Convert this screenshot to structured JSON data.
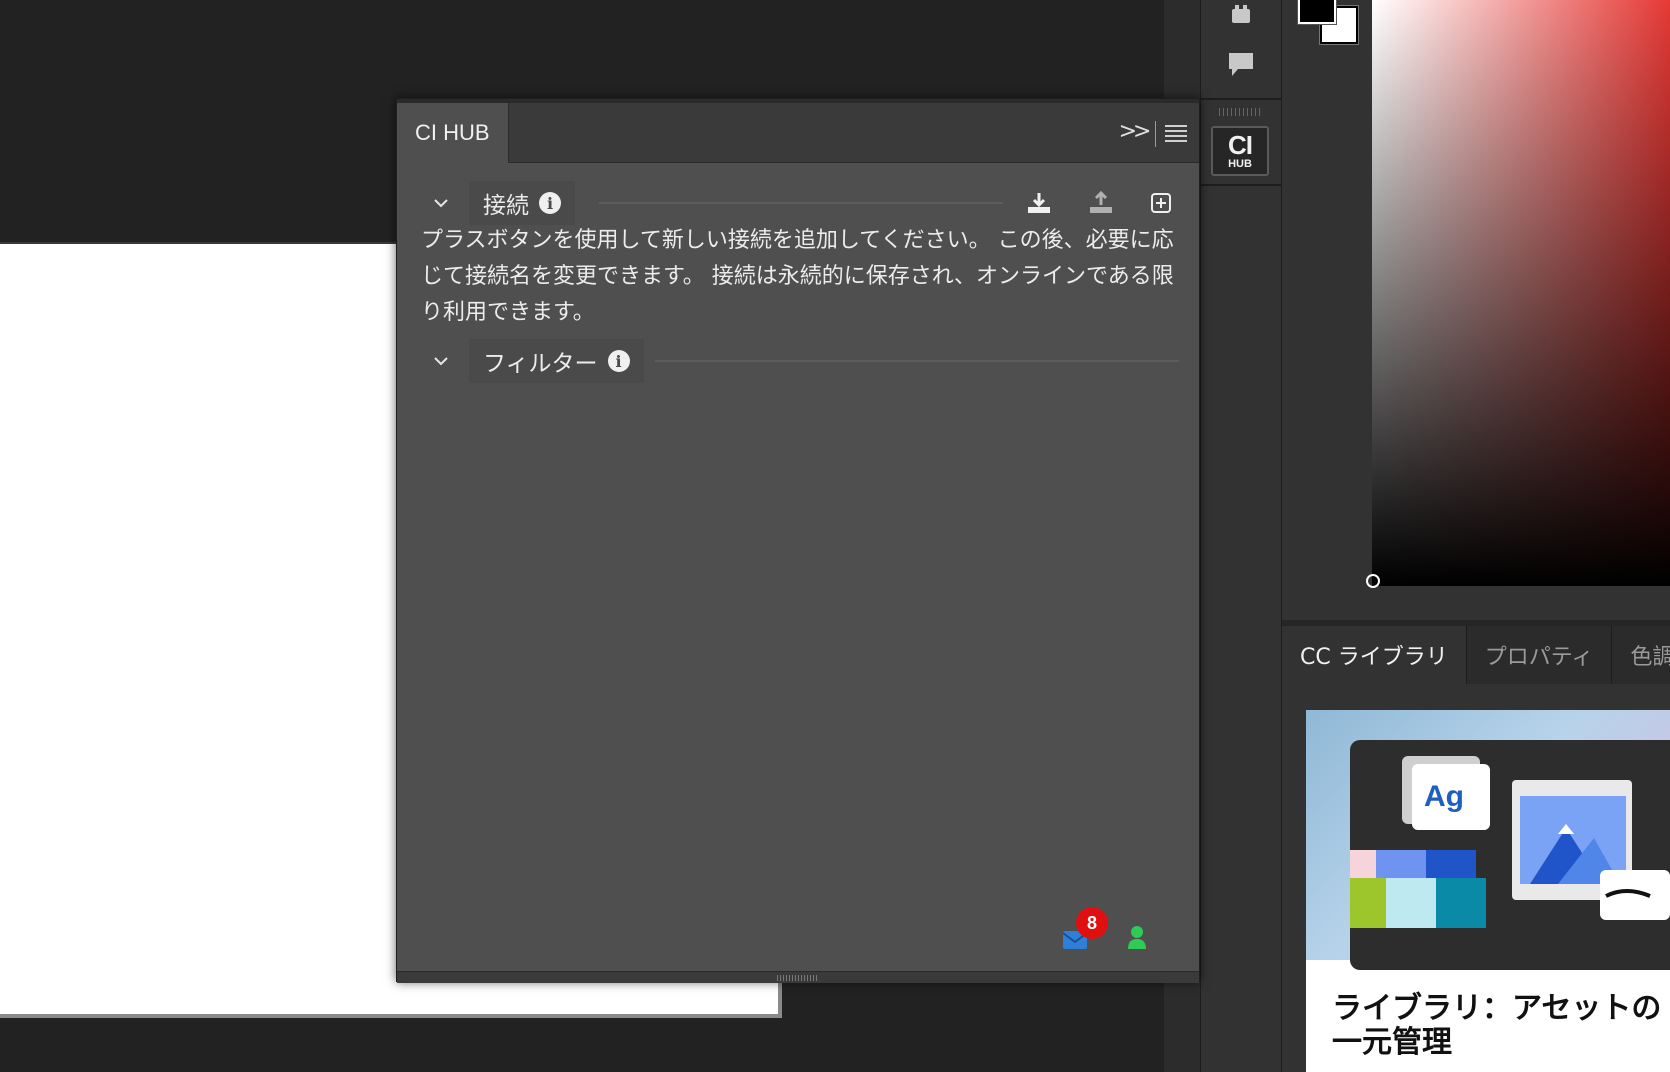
{
  "ci_hub_panel": {
    "tab_label": "CI HUB",
    "collapse_glyph": ">>",
    "sections": {
      "connections": {
        "label": "接続"
      },
      "filters": {
        "label": "フィルター"
      }
    },
    "help_text": "プラスボタンを使用して新しい接続を追加してください。 この後、必要に応じて接続名を変更できます。 接続は永続的に保存され、オンラインである限り利用できます。",
    "footer": {
      "notification_count": "8",
      "mail_color": "#2f7fd8",
      "user_color": "#2ecc55"
    }
  },
  "toolbar": {
    "cihub_button": {
      "line1": "CI",
      "line2": "HUB"
    }
  },
  "libraries_panel": {
    "tabs": [
      {
        "label": "CC ライブラリ",
        "active": true
      },
      {
        "label": "プロパティ",
        "active": false
      },
      {
        "label": "色調",
        "active": false
      }
    ],
    "card": {
      "title": "ライブラリ：アセットの一元管理",
      "art_text": "Ag"
    }
  },
  "colors": {
    "accent_red": "#e53935",
    "badge_red": "#e01010"
  }
}
